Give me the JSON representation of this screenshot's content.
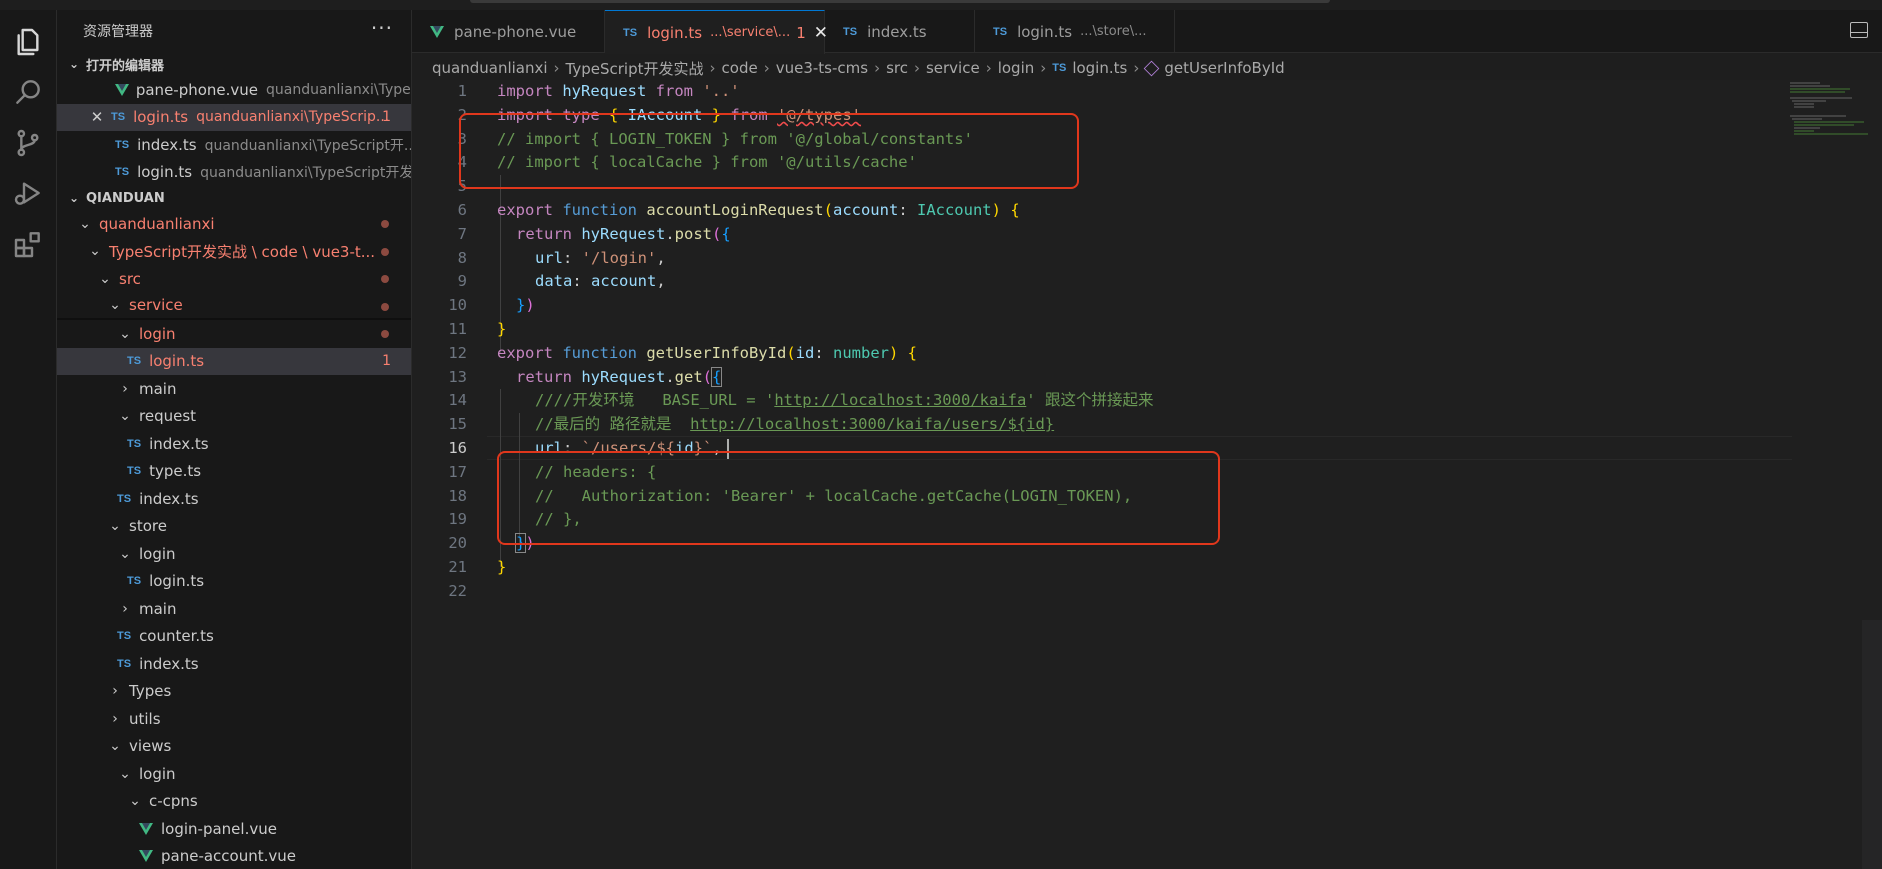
{
  "sidebar": {
    "title": "资源管理器",
    "more": "···",
    "open_editors": {
      "title": "打开的编辑器",
      "items": [
        {
          "icon": "vue-icon",
          "name": "pane-phone.vue",
          "desc": "quanduanlianxi\\Type..."
        },
        {
          "icon": "ts-icon",
          "close": "✕",
          "name": "login.ts",
          "desc": "quanduanlianxi\\TypeScrip...",
          "count": "1"
        },
        {
          "icon": "ts-icon",
          "name": "index.ts",
          "desc": "quanduanlianxi\\TypeScript开..."
        },
        {
          "icon": "ts-icon",
          "name": "login.ts",
          "desc": "quanduanlianxi\\TypeScript开发..."
        }
      ]
    },
    "folder": {
      "title": "QIANDUAN",
      "tree": [
        {
          "label": "quanduanlianxi"
        },
        {
          "label": "TypeScript开发实战 \\ code \\ vue3-t..."
        },
        {
          "label": "src"
        },
        {
          "label": "service"
        },
        {
          "label": "login"
        },
        {
          "label": "login.ts",
          "count": "1"
        },
        {
          "label": "main"
        },
        {
          "label": "request"
        },
        {
          "label": "index.ts"
        },
        {
          "label": "type.ts"
        },
        {
          "label": "index.ts"
        },
        {
          "label": "store"
        },
        {
          "label": "login"
        },
        {
          "label": "login.ts"
        },
        {
          "label": "main"
        },
        {
          "label": "counter.ts"
        },
        {
          "label": "index.ts"
        },
        {
          "label": "Types"
        },
        {
          "label": "utils"
        },
        {
          "label": "views"
        },
        {
          "label": "login"
        },
        {
          "label": "c-cpns"
        },
        {
          "label": "login-panel.vue"
        },
        {
          "label": "pane-account.vue"
        }
      ]
    }
  },
  "tabs": [
    {
      "name": "pane-phone.vue",
      "desc": ""
    },
    {
      "name": "login.ts",
      "desc": "...\\service\\...",
      "count": "1",
      "close": "✕"
    },
    {
      "name": "index.ts",
      "desc": ""
    },
    {
      "name": "login.ts",
      "desc": "...\\store\\..."
    }
  ],
  "ts_badge": "TS",
  "breadcrumb": [
    "quanduanlianxi",
    "TypeScript开发实战",
    "code",
    "vue3-ts-cms",
    "src",
    "service",
    "login",
    "login.ts",
    "getUserInfoById"
  ],
  "editor": {
    "line_numbers": [
      "1",
      "2",
      "3",
      "4",
      "5",
      "6",
      "7",
      "8",
      "9",
      "10",
      "11",
      "12",
      "13",
      "14",
      "15",
      "16",
      "17",
      "18",
      "19",
      "20",
      "21",
      "22"
    ],
    "current_line": "16",
    "tokens": {
      "l1": [
        "import",
        " hyRequest ",
        "from",
        " '..'"
      ],
      "l2": [
        "import",
        " type ",
        "{",
        " IAccount ",
        "}",
        " from ",
        "'@/types'"
      ],
      "l3": "// import { LOGIN_TOKEN } from '@/global/constants'",
      "l4": "// import { localCache } from '@/utils/cache'",
      "l6": [
        "export",
        " function ",
        "accountLoginRequest",
        "(",
        "account",
        ": ",
        "IAccount",
        ")",
        " {"
      ],
      "l7": [
        "return",
        " hyRequest",
        ".",
        "post",
        "(",
        "{"
      ],
      "l8": [
        "url",
        ": ",
        "'/login'",
        ","
      ],
      "l9": [
        "data",
        ": ",
        "account",
        ","
      ],
      "l10": [
        "}",
        ")"
      ],
      "l11": "}",
      "l12": [
        "export",
        " function ",
        "getUserInfoById",
        "(",
        "id",
        ": ",
        "number",
        ")",
        " {"
      ],
      "l13": [
        "return",
        " hyRequest",
        ".",
        "get",
        "(",
        "{"
      ],
      "l14": [
        "////开发环境   BASE_URL = '",
        "http://localhost:3000/kaifa",
        "' 跟这个拼接起来"
      ],
      "l15": [
        "//最后的 路径就是  ",
        "http://localhost:3000/kaifa/users/${id}"
      ],
      "l16": [
        "url",
        ": ",
        "`/users/${",
        "id",
        "}`",
        ","
      ],
      "l17": "// headers: {",
      "l18": "//   Authorization: 'Bearer' + localCache.getCache(LOGIN_TOKEN),",
      "l19": "// },",
      "l20": [
        "}",
        ")"
      ],
      "l21": "}"
    }
  },
  "colors": {
    "accent": "#0078d4",
    "error": "#f88070",
    "annotation": "#e0371c"
  }
}
